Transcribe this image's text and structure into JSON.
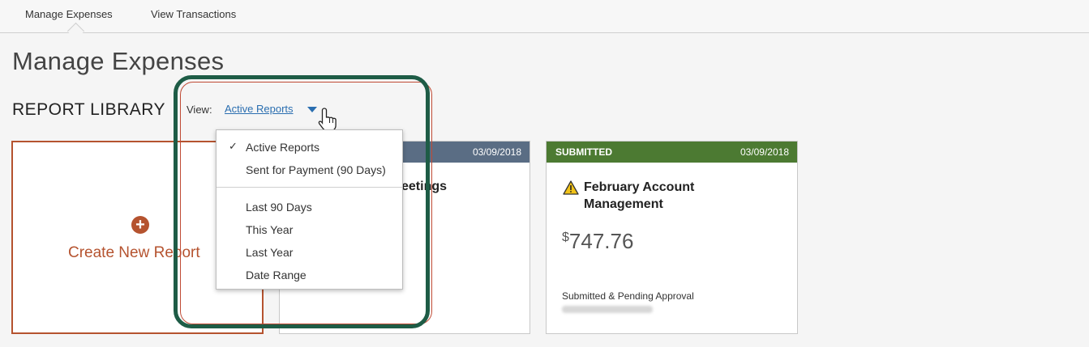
{
  "nav": {
    "tabs": [
      {
        "label": "Manage Expenses",
        "active": true
      },
      {
        "label": "View Transactions",
        "active": false
      }
    ]
  },
  "page": {
    "title": "Manage Expenses",
    "section_title": "REPORT LIBRARY"
  },
  "view_filter": {
    "label": "View:",
    "selected": "Active Reports"
  },
  "dropdown": {
    "group1": [
      {
        "label": "Active Reports",
        "checked": true
      },
      {
        "label": "Sent for Payment (90 Days)",
        "checked": false
      }
    ],
    "group2": [
      {
        "label": "Last 90 Days"
      },
      {
        "label": "This Year"
      },
      {
        "label": "Last Year"
      },
      {
        "label": "Date Range"
      }
    ]
  },
  "create_card": {
    "label": "Create New Report"
  },
  "reports": [
    {
      "date": "03/09/2018",
      "name_visible_fragment": "eetings",
      "header_color": "#5a6d84"
    },
    {
      "status": "SUBMITTED",
      "date": "03/09/2018",
      "name": "February Account Management",
      "currency": "$",
      "amount": "747.76",
      "approval_status": "Submitted & Pending Approval",
      "header_color": "#4c7a32",
      "warning": true
    }
  ],
  "colors": {
    "accent": "#b5532f",
    "link": "#2a6eb0",
    "highlight": "#1e5c46"
  }
}
